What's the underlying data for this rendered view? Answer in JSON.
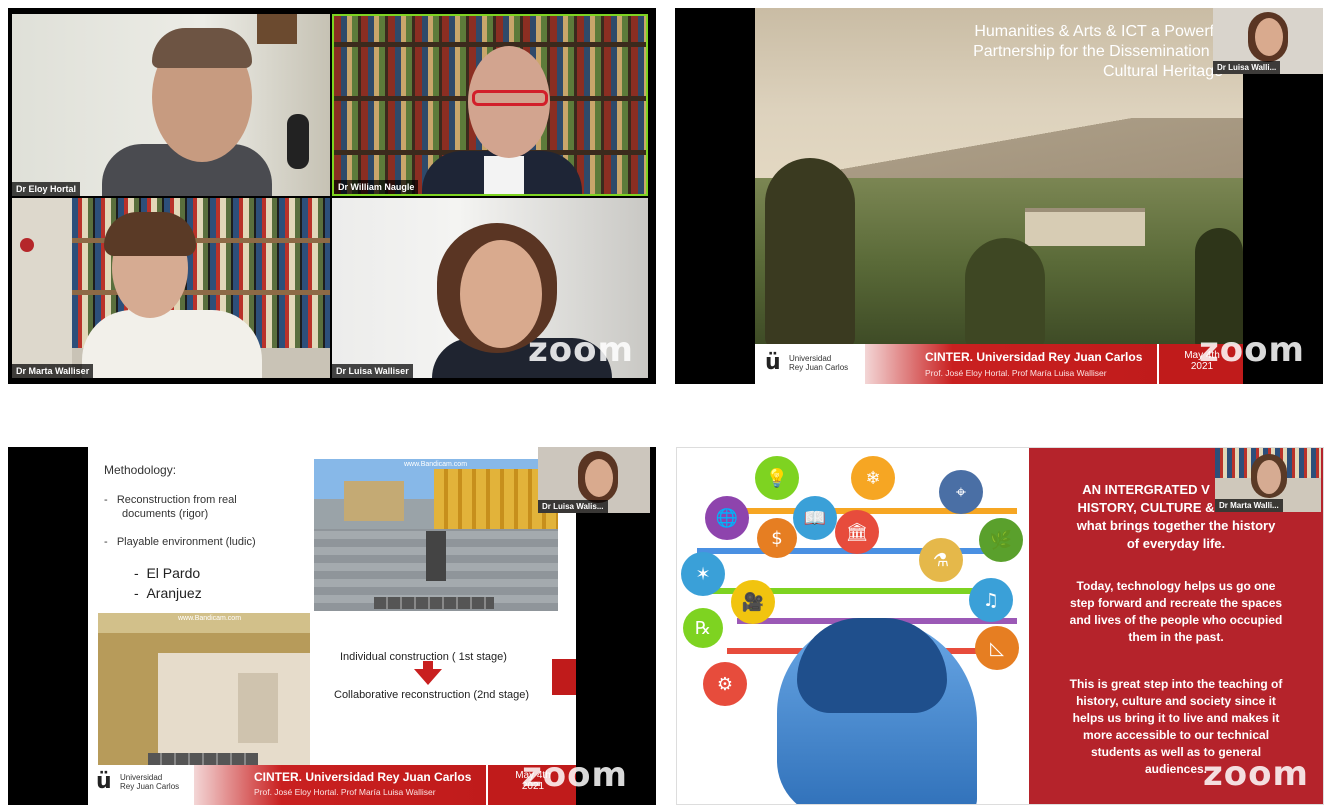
{
  "zoom_brand": "zoom",
  "gallery": {
    "participants": [
      {
        "name": "Dr Eloy Hortal"
      },
      {
        "name": "Dr William Naugle"
      },
      {
        "name": "Dr Marta Walliser"
      },
      {
        "name": "Dr Luisa Walliser"
      }
    ]
  },
  "slide1": {
    "title_lines": [
      "Humanities & Arts & ICT a Powerfu",
      "Partnership for the Dissemination o",
      "Cultural Heritage"
    ],
    "thumbnail_name": "Dr Luisa Walli...",
    "university_line1": "Universidad",
    "university_line2": "Rey Juan Carlos",
    "footer_title": "CINTER. Universidad Rey Juan Carlos",
    "footer_sub": "Prof. José Eloy Hortal. Prof María Luisa Walliser",
    "date_line1": "May 4th",
    "date_line2": "2021"
  },
  "slide2": {
    "heading": "Methodology:",
    "bullet1_line1": "Reconstruction from real",
    "bullet1_line2": "documents (rigor)",
    "bullet2": "Playable environment (ludic)",
    "sub1": "El Pardo",
    "sub2": "Aranjuez",
    "dash": "-",
    "shot_watermark": "www.Bandicam.com",
    "stage1": "Individual construction ( 1st stage)",
    "stage2": "Collaborative reconstruction (2nd stage)",
    "thumbnail_name": "Dr Luisa Walis...",
    "university_line1": "Universidad",
    "university_line2": "Rey Juan Carlos",
    "footer_title": "CINTER. Universidad Rey Juan Carlos",
    "footer_sub": "Prof. José Eloy Hortal. Prof María Luisa Walliser",
    "date_line1": "May 4th",
    "date_line2": "2021"
  },
  "slide3": {
    "thumbnail_name": "Dr Marta Walli...",
    "heading_line1": "AN INTERGRATED V",
    "heading_line2": "HISTORY, CULTURE &",
    "heading_line3": "what brings together the history",
    "heading_line4": "of everyday life.",
    "para1": [
      "Today, technology helps us go one",
      "step forward and recreate the spaces",
      "and lives of the people who occupied",
      "them in the past."
    ],
    "para2": [
      "This is great step into the teaching of",
      "history, culture and society since it",
      "helps us bring it to live and makes it",
      "more accessible to our technical",
      "students as well as to general",
      "audiences."
    ]
  },
  "colors": {
    "slide_red": "#c01b1b",
    "text_panel_red": "#b5232b",
    "active_speaker": "#7ed321"
  }
}
